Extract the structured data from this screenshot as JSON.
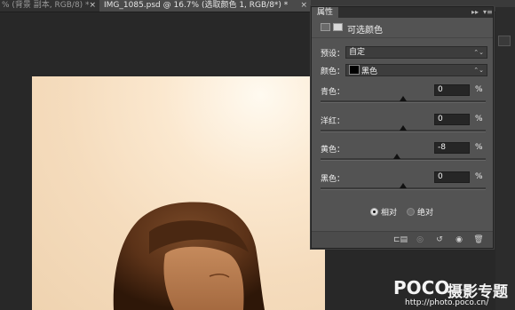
{
  "tabs": {
    "inactive_label": "% (背景 副本, RGB/8) *",
    "active_label": "IMG_1085.psd @ 16.7% (选取颜色 1, RGB/8*) *",
    "close_glyph": "×"
  },
  "panel": {
    "title": "属性",
    "collapse_glyph": "▸▸",
    "menu_glyph": "▾≡",
    "adjustment_title": "可选颜色",
    "preset": {
      "label": "预设：",
      "value": "自定",
      "arrow": "⌃⌄"
    },
    "colors": {
      "label": "颜色：",
      "value": "黑色",
      "swatch": "#000000",
      "arrow": "⌃⌄"
    },
    "sliders": [
      {
        "label": "青色：",
        "value": "0",
        "unit": "%",
        "percent": 0
      },
      {
        "label": "洋红：",
        "value": "0",
        "unit": "%",
        "percent": 0
      },
      {
        "label": "黄色：",
        "value": "-8",
        "unit": "%",
        "percent": -8
      },
      {
        "label": "黑色：",
        "value": "0",
        "unit": "%",
        "percent": 0
      }
    ],
    "method": {
      "relative": "相对",
      "absolute": "绝对",
      "selected": "relative"
    },
    "footer_icons": [
      "clip-icon",
      "visibility-preview-icon",
      "reset-icon",
      "eye-icon",
      "trash-icon"
    ]
  },
  "watermark": {
    "brand": "POCO",
    "title": "摄影专题",
    "url": "http://photo.poco.cn/"
  },
  "colors": {
    "panel_bg": "#535353",
    "canvas_bg": "#282828"
  }
}
